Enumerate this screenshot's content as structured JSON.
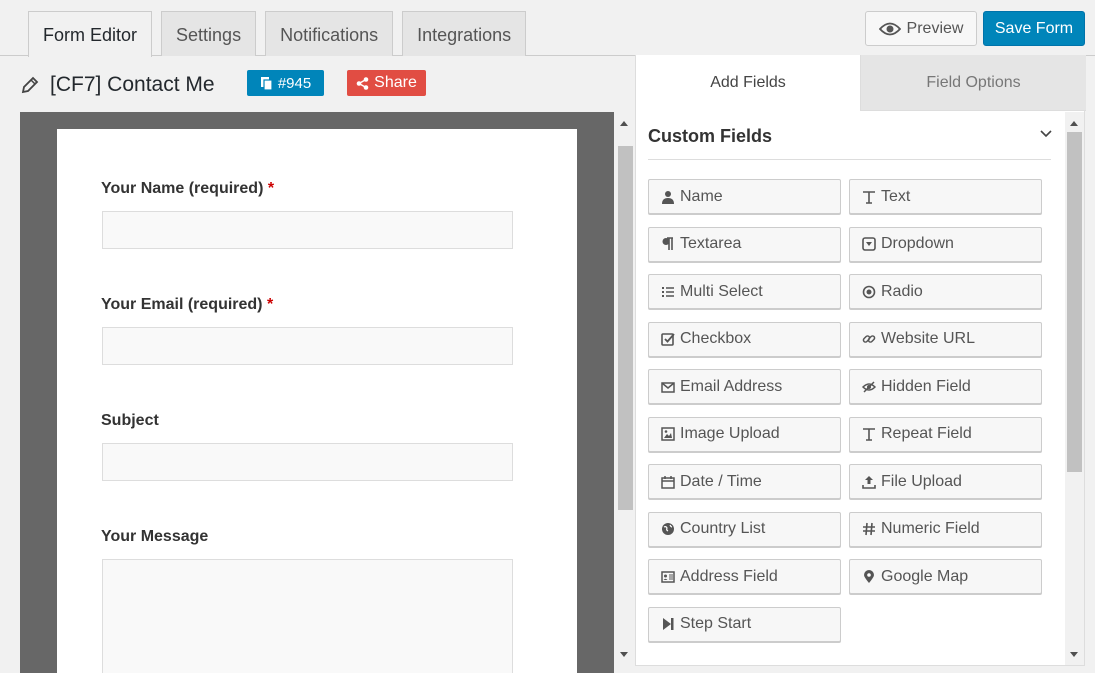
{
  "tabs": [
    {
      "label": "Form Editor",
      "active": true
    },
    {
      "label": "Settings",
      "active": false
    },
    {
      "label": "Notifications",
      "active": false
    },
    {
      "label": "Integrations",
      "active": false
    }
  ],
  "toolbar": {
    "preview_label": "Preview",
    "save_label": "Save Form"
  },
  "form": {
    "title": "[CF7] Contact Me",
    "id_badge": "#945",
    "share_label": "Share"
  },
  "preview": {
    "fields": [
      {
        "label": "Your Name (required)",
        "required_mark": "*"
      },
      {
        "label": "Your Email (required)",
        "required_mark": "*"
      },
      {
        "label": "Subject",
        "required_mark": ""
      },
      {
        "label": "Your Message",
        "required_mark": ""
      }
    ]
  },
  "panel": {
    "tabs": [
      {
        "label": "Add Fields"
      },
      {
        "label": "Field Options"
      }
    ],
    "section_title": "Custom Fields",
    "buttons": [
      {
        "label": "Name",
        "icon": "user-icon"
      },
      {
        "label": "Text",
        "icon": "text-icon"
      },
      {
        "label": "Textarea",
        "icon": "paragraph-icon"
      },
      {
        "label": "Dropdown",
        "icon": "dropdown-icon"
      },
      {
        "label": "Multi Select",
        "icon": "list-icon"
      },
      {
        "label": "Radio",
        "icon": "radio-icon"
      },
      {
        "label": "Checkbox",
        "icon": "checkbox-icon"
      },
      {
        "label": "Website URL",
        "icon": "link-icon"
      },
      {
        "label": "Email Address",
        "icon": "envelope-icon"
      },
      {
        "label": "Hidden Field",
        "icon": "eye-slash-icon"
      },
      {
        "label": "Image Upload",
        "icon": "image-icon"
      },
      {
        "label": "Repeat Field",
        "icon": "text-icon"
      },
      {
        "label": "Date / Time",
        "icon": "calendar-icon"
      },
      {
        "label": "File Upload",
        "icon": "upload-icon"
      },
      {
        "label": "Country List",
        "icon": "globe-icon"
      },
      {
        "label": "Numeric Field",
        "icon": "hash-icon"
      },
      {
        "label": "Address Field",
        "icon": "address-card-icon"
      },
      {
        "label": "Google Map",
        "icon": "map-marker-icon"
      },
      {
        "label": "Step Start",
        "icon": "step-forward-icon"
      }
    ]
  },
  "colors": {
    "primary": "#0085ba",
    "share": "#e14d43",
    "required": "#cc0000"
  }
}
